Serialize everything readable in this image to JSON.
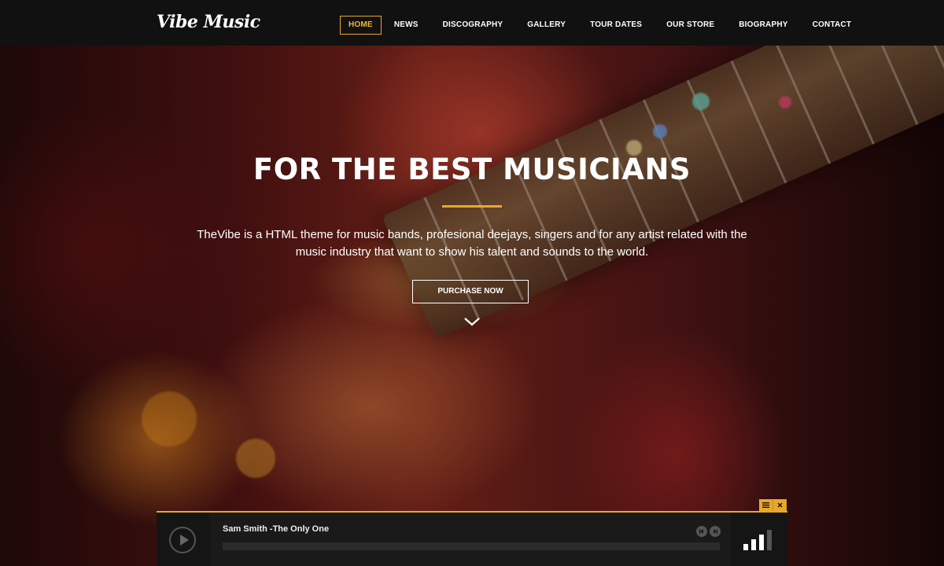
{
  "brand": {
    "logo": "Vibe Music"
  },
  "nav": {
    "items": [
      {
        "label": "HOME"
      },
      {
        "label": "NEWS"
      },
      {
        "label": "DISCOGRAPHY"
      },
      {
        "label": "GALLERY"
      },
      {
        "label": "TOUR DATES"
      },
      {
        "label": "OUR STORE"
      },
      {
        "label": "BIOGRAPHY"
      },
      {
        "label": "CONTACT"
      }
    ],
    "active": "HOME"
  },
  "hero": {
    "title": "FOR THE BEST MUSICIANS",
    "text": "TheVibe is a HTML theme for music bands, profesional deejays, singers and for any artist related with the music industry that want to show his talent and sounds to the world.",
    "button_label": "PURCHASE NOW",
    "scroll_icon": "chevron-down-icon"
  },
  "player": {
    "track_title": "Sam Smith -The Only One",
    "progress": 0,
    "volume_level": 3,
    "volume_max": 4,
    "icons": {
      "playlist": "playlist-icon",
      "close": "close-icon",
      "play": "play-icon",
      "prev": "previous-icon",
      "next": "next-icon",
      "volume": "volume-bars-icon"
    }
  },
  "colors": {
    "accent": "#e8a82a",
    "topbar": "#111111",
    "player_bg": "#1a1a1a"
  }
}
